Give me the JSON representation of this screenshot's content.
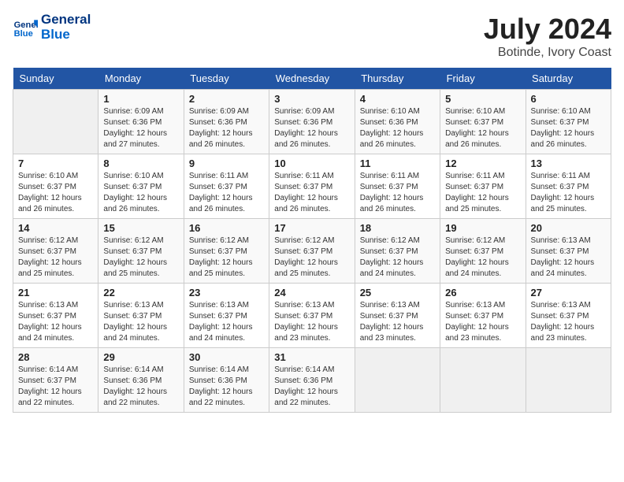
{
  "logo": {
    "line1": "General",
    "line2": "Blue"
  },
  "title": "July 2024",
  "location": "Botinde, Ivory Coast",
  "days_header": [
    "Sunday",
    "Monday",
    "Tuesday",
    "Wednesday",
    "Thursday",
    "Friday",
    "Saturday"
  ],
  "weeks": [
    [
      {
        "day": "",
        "sunrise": "",
        "sunset": "",
        "daylight": ""
      },
      {
        "day": "1",
        "sunrise": "6:09 AM",
        "sunset": "6:36 PM",
        "daylight": "12 hours and 27 minutes."
      },
      {
        "day": "2",
        "sunrise": "6:09 AM",
        "sunset": "6:36 PM",
        "daylight": "12 hours and 26 minutes."
      },
      {
        "day": "3",
        "sunrise": "6:09 AM",
        "sunset": "6:36 PM",
        "daylight": "12 hours and 26 minutes."
      },
      {
        "day": "4",
        "sunrise": "6:10 AM",
        "sunset": "6:36 PM",
        "daylight": "12 hours and 26 minutes."
      },
      {
        "day": "5",
        "sunrise": "6:10 AM",
        "sunset": "6:37 PM",
        "daylight": "12 hours and 26 minutes."
      },
      {
        "day": "6",
        "sunrise": "6:10 AM",
        "sunset": "6:37 PM",
        "daylight": "12 hours and 26 minutes."
      }
    ],
    [
      {
        "day": "7",
        "sunrise": "6:10 AM",
        "sunset": "6:37 PM",
        "daylight": "12 hours and 26 minutes."
      },
      {
        "day": "8",
        "sunrise": "6:10 AM",
        "sunset": "6:37 PM",
        "daylight": "12 hours and 26 minutes."
      },
      {
        "day": "9",
        "sunrise": "6:11 AM",
        "sunset": "6:37 PM",
        "daylight": "12 hours and 26 minutes."
      },
      {
        "day": "10",
        "sunrise": "6:11 AM",
        "sunset": "6:37 PM",
        "daylight": "12 hours and 26 minutes."
      },
      {
        "day": "11",
        "sunrise": "6:11 AM",
        "sunset": "6:37 PM",
        "daylight": "12 hours and 26 minutes."
      },
      {
        "day": "12",
        "sunrise": "6:11 AM",
        "sunset": "6:37 PM",
        "daylight": "12 hours and 25 minutes."
      },
      {
        "day": "13",
        "sunrise": "6:11 AM",
        "sunset": "6:37 PM",
        "daylight": "12 hours and 25 minutes."
      }
    ],
    [
      {
        "day": "14",
        "sunrise": "6:12 AM",
        "sunset": "6:37 PM",
        "daylight": "12 hours and 25 minutes."
      },
      {
        "day": "15",
        "sunrise": "6:12 AM",
        "sunset": "6:37 PM",
        "daylight": "12 hours and 25 minutes."
      },
      {
        "day": "16",
        "sunrise": "6:12 AM",
        "sunset": "6:37 PM",
        "daylight": "12 hours and 25 minutes."
      },
      {
        "day": "17",
        "sunrise": "6:12 AM",
        "sunset": "6:37 PM",
        "daylight": "12 hours and 25 minutes."
      },
      {
        "day": "18",
        "sunrise": "6:12 AM",
        "sunset": "6:37 PM",
        "daylight": "12 hours and 24 minutes."
      },
      {
        "day": "19",
        "sunrise": "6:12 AM",
        "sunset": "6:37 PM",
        "daylight": "12 hours and 24 minutes."
      },
      {
        "day": "20",
        "sunrise": "6:13 AM",
        "sunset": "6:37 PM",
        "daylight": "12 hours and 24 minutes."
      }
    ],
    [
      {
        "day": "21",
        "sunrise": "6:13 AM",
        "sunset": "6:37 PM",
        "daylight": "12 hours and 24 minutes."
      },
      {
        "day": "22",
        "sunrise": "6:13 AM",
        "sunset": "6:37 PM",
        "daylight": "12 hours and 24 minutes."
      },
      {
        "day": "23",
        "sunrise": "6:13 AM",
        "sunset": "6:37 PM",
        "daylight": "12 hours and 24 minutes."
      },
      {
        "day": "24",
        "sunrise": "6:13 AM",
        "sunset": "6:37 PM",
        "daylight": "12 hours and 23 minutes."
      },
      {
        "day": "25",
        "sunrise": "6:13 AM",
        "sunset": "6:37 PM",
        "daylight": "12 hours and 23 minutes."
      },
      {
        "day": "26",
        "sunrise": "6:13 AM",
        "sunset": "6:37 PM",
        "daylight": "12 hours and 23 minutes."
      },
      {
        "day": "27",
        "sunrise": "6:13 AM",
        "sunset": "6:37 PM",
        "daylight": "12 hours and 23 minutes."
      }
    ],
    [
      {
        "day": "28",
        "sunrise": "6:14 AM",
        "sunset": "6:37 PM",
        "daylight": "12 hours and 22 minutes."
      },
      {
        "day": "29",
        "sunrise": "6:14 AM",
        "sunset": "6:36 PM",
        "daylight": "12 hours and 22 minutes."
      },
      {
        "day": "30",
        "sunrise": "6:14 AM",
        "sunset": "6:36 PM",
        "daylight": "12 hours and 22 minutes."
      },
      {
        "day": "31",
        "sunrise": "6:14 AM",
        "sunset": "6:36 PM",
        "daylight": "12 hours and 22 minutes."
      },
      {
        "day": "",
        "sunrise": "",
        "sunset": "",
        "daylight": ""
      },
      {
        "day": "",
        "sunrise": "",
        "sunset": "",
        "daylight": ""
      },
      {
        "day": "",
        "sunrise": "",
        "sunset": "",
        "daylight": ""
      }
    ]
  ]
}
